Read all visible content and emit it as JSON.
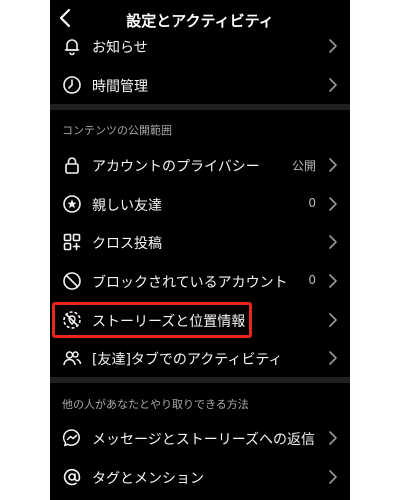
{
  "header": {
    "title": "設定とアクティビティ"
  },
  "top_items": [
    {
      "label": "お知らせ",
      "icon": "bell-icon"
    },
    {
      "label": "時間管理",
      "icon": "clock-icon"
    }
  ],
  "section1": {
    "title": "コンテンツの公開範囲",
    "items": [
      {
        "label": "アカウントのプライバシー",
        "value": "公開",
        "icon": "lock-icon"
      },
      {
        "label": "親しい友達",
        "value": "0",
        "icon": "star-circle-icon"
      },
      {
        "label": "クロス投稿",
        "icon": "grid-plus-icon"
      },
      {
        "label": "ブロックされているアカウント",
        "value": "0",
        "icon": "block-icon"
      },
      {
        "label": "ストーリーズと位置情報",
        "icon": "story-location-icon"
      },
      {
        "label": "[友達]タブでのアクティビティ",
        "icon": "people-icon"
      }
    ]
  },
  "section2": {
    "title": "他の人があなたとやり取りできる方法",
    "items": [
      {
        "label": "メッセージとストーリーズへの返信",
        "icon": "messenger-icon"
      },
      {
        "label": "タグとメンション",
        "icon": "at-sign-icon"
      }
    ]
  },
  "colors": {
    "background": "#000000",
    "highlight": "#e8261a",
    "text": "#f5f5f5",
    "muted": "#a8a8a8"
  }
}
